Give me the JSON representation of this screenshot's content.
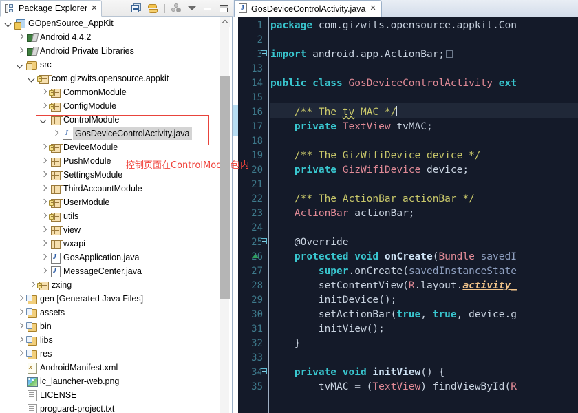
{
  "explorer": {
    "tab_label": "Package Explorer",
    "tab_close": "✕",
    "toolbar": [
      {
        "name": "collapse-all-icon",
        "title": "Collapse All"
      },
      {
        "name": "link-with-editor-icon",
        "title": "Link with Editor"
      },
      {
        "name": "focus-on-active-task-icon",
        "title": "Focus on Active Task"
      },
      {
        "name": "view-menu-icon",
        "title": "View Menu"
      },
      {
        "name": "minimize-icon",
        "title": "Minimize"
      },
      {
        "name": "maximize-icon",
        "title": "Maximize"
      }
    ],
    "tree": [
      {
        "label": "GOpenSource_AppKit",
        "indent": 0,
        "twisty": "expanded",
        "icon": "project-icon"
      },
      {
        "label": "Android 4.4.2",
        "indent": 1,
        "twisty": "collapsed",
        "icon": "library-icon"
      },
      {
        "label": "Android Private Libraries",
        "indent": 1,
        "twisty": "collapsed",
        "icon": "library-icon"
      },
      {
        "label": "src",
        "indent": 1,
        "twisty": "expanded",
        "icon": "source-folder-icon"
      },
      {
        "label": "com.gizwits.opensource.appkit",
        "indent": 2,
        "twisty": "expanded",
        "icon": "package-lock-icon"
      },
      {
        "label": "CommonModule",
        "indent": 3,
        "twisty": "collapsed",
        "icon": "package-lock-icon"
      },
      {
        "label": "ConfigModule",
        "indent": 3,
        "twisty": "collapsed",
        "icon": "package-lock-icon"
      },
      {
        "label": "ControlModule",
        "indent": 3,
        "twisty": "expanded",
        "icon": "package-icon"
      },
      {
        "label": "GosDeviceControlActivity.java",
        "indent": 4,
        "twisty": "collapsed",
        "icon": "java-file-icon",
        "selected": true
      },
      {
        "label": "DeviceModule",
        "indent": 3,
        "twisty": "collapsed",
        "icon": "package-lock-icon"
      },
      {
        "label": "PushModule",
        "indent": 3,
        "twisty": "collapsed",
        "icon": "package-icon"
      },
      {
        "label": "SettingsModule",
        "indent": 3,
        "twisty": "collapsed",
        "icon": "package-icon"
      },
      {
        "label": "ThirdAccountModule",
        "indent": 3,
        "twisty": "collapsed",
        "icon": "package-icon"
      },
      {
        "label": "UserModule",
        "indent": 3,
        "twisty": "collapsed",
        "icon": "package-lock-icon"
      },
      {
        "label": "utils",
        "indent": 3,
        "twisty": "collapsed",
        "icon": "package-lock-icon"
      },
      {
        "label": "view",
        "indent": 3,
        "twisty": "collapsed",
        "icon": "package-icon"
      },
      {
        "label": "wxapi",
        "indent": 3,
        "twisty": "collapsed",
        "icon": "package-icon"
      },
      {
        "label": "GosApplication.java",
        "indent": 3,
        "twisty": "collapsed",
        "icon": "java-file-icon"
      },
      {
        "label": "MessageCenter.java",
        "indent": 3,
        "twisty": "collapsed",
        "icon": "java-file-icon"
      },
      {
        "label": "zxing",
        "indent": 2,
        "twisty": "collapsed",
        "icon": "package-lock-icon"
      },
      {
        "label": "gen",
        "suffix": " [Generated Java Files]",
        "indent": 1,
        "twisty": "collapsed",
        "icon": "gen-folder-icon"
      },
      {
        "label": "assets",
        "indent": 1,
        "twisty": "collapsed",
        "icon": "gen-folder-icon"
      },
      {
        "label": "bin",
        "indent": 1,
        "twisty": "collapsed",
        "icon": "gen-folder-icon"
      },
      {
        "label": "libs",
        "indent": 1,
        "twisty": "collapsed",
        "icon": "gen-folder-icon"
      },
      {
        "label": "res",
        "indent": 1,
        "twisty": "collapsed",
        "icon": "gen-folder-icon"
      },
      {
        "label": "AndroidManifest.xml",
        "indent": 1,
        "twisty": "none",
        "icon": "xml-file-icon"
      },
      {
        "label": "ic_launcher-web.png",
        "indent": 1,
        "twisty": "none",
        "icon": "image-file-icon"
      },
      {
        "label": "LICENSE",
        "indent": 1,
        "twisty": "none",
        "icon": "text-file-icon"
      },
      {
        "label": "proguard-project.txt",
        "indent": 1,
        "twisty": "none",
        "icon": "text-file-icon"
      }
    ],
    "annotation": {
      "note_text": "控制页面在ControlModule包内",
      "color": "#f0423a"
    }
  },
  "editor": {
    "tab_label": "GosDeviceControlActivity.java",
    "tab_close": "✕",
    "current_line": 16,
    "lines": [
      {
        "n": 1,
        "fold": null,
        "tokens": [
          {
            "t": "package ",
            "c": "k"
          },
          {
            "t": "com.gizwits.opensource.appkit.Con",
            "c": "pl"
          }
        ]
      },
      {
        "n": 2,
        "fold": null,
        "tokens": []
      },
      {
        "n": 3,
        "fold": "plus",
        "tokens": [
          {
            "t": "import ",
            "c": "k"
          },
          {
            "t": "android.app.ActionBar;",
            "c": "pl"
          },
          {
            "t": "□",
            "c": "box"
          }
        ]
      },
      {
        "n": 13,
        "fold": null,
        "tokens": []
      },
      {
        "n": 14,
        "fold": null,
        "tokens": [
          {
            "t": "public class ",
            "c": "k"
          },
          {
            "t": "GosDeviceControlActivity",
            "c": "ty"
          },
          {
            "t": " ",
            "c": "pl"
          },
          {
            "t": "ext",
            "c": "k"
          }
        ]
      },
      {
        "n": 15,
        "fold": null,
        "tokens": []
      },
      {
        "n": 16,
        "fold": null,
        "tokens": [
          {
            "t": "    /** The ",
            "c": "cm"
          },
          {
            "t": "tv",
            "c": "cmw"
          },
          {
            "t": " MAC */",
            "c": "cm"
          },
          {
            "t": "|",
            "c": "caret"
          }
        ]
      },
      {
        "n": 17,
        "fold": null,
        "tokens": [
          {
            "t": "    private ",
            "c": "k"
          },
          {
            "t": "TextView",
            "c": "ty"
          },
          {
            "t": " tvMAC;",
            "c": "pl"
          }
        ]
      },
      {
        "n": 18,
        "fold": null,
        "tokens": []
      },
      {
        "n": 19,
        "fold": null,
        "tokens": [
          {
            "t": "    /** The GizWifiDevice device */",
            "c": "cm"
          }
        ]
      },
      {
        "n": 20,
        "fold": null,
        "tokens": [
          {
            "t": "    private ",
            "c": "k"
          },
          {
            "t": "GizWifiDevice",
            "c": "ty"
          },
          {
            "t": " device;",
            "c": "pl"
          }
        ]
      },
      {
        "n": 21,
        "fold": null,
        "tokens": []
      },
      {
        "n": 22,
        "fold": null,
        "tokens": [
          {
            "t": "    /** The ActionBar actionBar */",
            "c": "cm"
          }
        ]
      },
      {
        "n": 23,
        "fold": null,
        "tokens": [
          {
            "t": "    ",
            "c": "pl"
          },
          {
            "t": "ActionBar",
            "c": "ty"
          },
          {
            "t": " actionBar;",
            "c": "pl"
          }
        ]
      },
      {
        "n": 24,
        "fold": null,
        "tokens": []
      },
      {
        "n": 25,
        "fold": "minus",
        "tokens": [
          {
            "t": "    @Override",
            "c": "an"
          }
        ]
      },
      {
        "n": 26,
        "fold": null,
        "override": true,
        "tokens": [
          {
            "t": "    protected void ",
            "c": "k"
          },
          {
            "t": "onCreate",
            "c": "fn"
          },
          {
            "t": "(",
            "c": "pl"
          },
          {
            "t": "Bundle",
            "c": "ty"
          },
          {
            "t": " ",
            "c": "pl"
          },
          {
            "t": "savedI",
            "c": "sp"
          }
        ]
      },
      {
        "n": 27,
        "fold": null,
        "tokens": [
          {
            "t": "        ",
            "c": "pl"
          },
          {
            "t": "super",
            "c": "k"
          },
          {
            "t": ".onCreate(",
            "c": "pl"
          },
          {
            "t": "savedInstanceState",
            "c": "sp"
          }
        ]
      },
      {
        "n": 28,
        "fold": null,
        "tokens": [
          {
            "t": "        setContentView(",
            "c": "pl"
          },
          {
            "t": "R",
            "c": "ty"
          },
          {
            "t": ".layout.",
            "c": "pl"
          },
          {
            "t": "activity_",
            "c": "fd"
          }
        ]
      },
      {
        "n": 29,
        "fold": null,
        "tokens": [
          {
            "t": "        initDevice();",
            "c": "pl"
          }
        ]
      },
      {
        "n": 30,
        "fold": null,
        "tokens": [
          {
            "t": "        setActionBar(",
            "c": "pl"
          },
          {
            "t": "true",
            "c": "k"
          },
          {
            "t": ", ",
            "c": "pl"
          },
          {
            "t": "true",
            "c": "k"
          },
          {
            "t": ", device.g",
            "c": "pl"
          }
        ]
      },
      {
        "n": 31,
        "fold": null,
        "tokens": [
          {
            "t": "        initView();",
            "c": "pl"
          }
        ]
      },
      {
        "n": 32,
        "fold": null,
        "tokens": [
          {
            "t": "    }",
            "c": "pl"
          }
        ]
      },
      {
        "n": 33,
        "fold": null,
        "tokens": []
      },
      {
        "n": 34,
        "fold": "minus",
        "tokens": [
          {
            "t": "    private void ",
            "c": "k"
          },
          {
            "t": "initView",
            "c": "fn"
          },
          {
            "t": "() {",
            "c": "pl"
          }
        ]
      },
      {
        "n": 35,
        "fold": null,
        "tokens": [
          {
            "t": "        tvMAC = (",
            "c": "pl"
          },
          {
            "t": "TextView",
            "c": "ty"
          },
          {
            "t": ") findViewById(",
            "c": "pl"
          },
          {
            "t": "R",
            "c": "ty"
          }
        ]
      }
    ],
    "colors": {
      "background": "#141a29",
      "keyword": "#39c6cf",
      "type": "#e08a96",
      "comment": "#c9c86a",
      "plain": "#c9d3e0",
      "line_number": "#3e7a8c",
      "current_line_bg": "#202838"
    }
  }
}
